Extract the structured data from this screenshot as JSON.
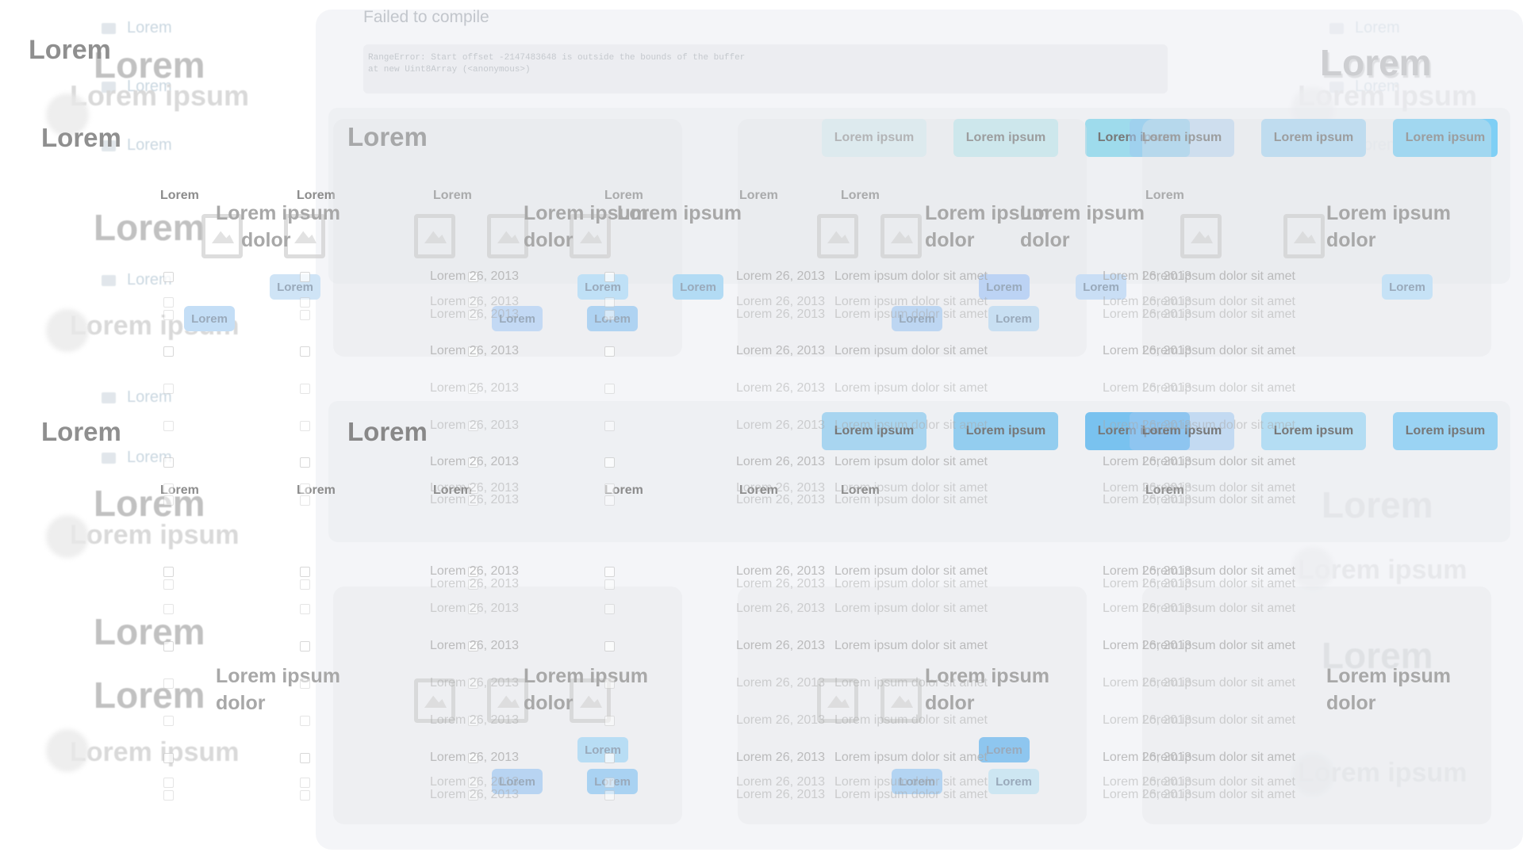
{
  "word": "Lorem",
  "lorem_ipsum": "Lorem ipsum",
  "lorem_ipsum_dolor": "Lorem ipsum dolor",
  "dolor": "dolor",
  "ipsum": "ipsum",
  "date": "Lorem 26, 2013",
  "date_short": "26, 2013",
  "sentence": "Lorem ipsum dolor sit amet",
  "overlay": {
    "title": "Failed to compile",
    "code_lines": [
      "RangeError: Start offset -2147483648 is outside the bounds of the buffer",
      "    at new Uint8Array (<anonymous>)"
    ]
  },
  "panels": [
    {
      "title": "Lorem",
      "buttons": [
        "Lorem ipsum",
        "Lorem ipsum",
        "Lorem ipsum",
        "Lorem ipsum",
        "Lorem ipsum",
        "Lorem ipsum"
      ],
      "columns": [
        "Lorem",
        "Lorem",
        "Lorem",
        "Lorem",
        "Lorem",
        "Lorem",
        "Lorem"
      ]
    },
    {
      "title": "Lorem",
      "buttons": [
        "Lorem ipsum",
        "Lorem ipsum",
        "Lorem ipsum",
        "Lorem ipsum",
        "Lorem ipsum",
        "Lorem ipsum"
      ],
      "columns": [
        "Lorem",
        "Lorem",
        "Lorem",
        "Lorem",
        "Lorem",
        "Lorem",
        "Lorem"
      ]
    }
  ],
  "rows": [
    {
      "date": "Lorem 26, 2013",
      "text": "Lorem ipsum dolor sit amet"
    },
    {
      "date": "Lorem 26, 2013",
      "text": "Lorem ipsum dolor sit amet"
    },
    {
      "date": "Lorem 26, 2013",
      "text": "Lorem ipsum dolor sit amet"
    },
    {
      "date": "Lorem 26, 2013",
      "text": "Lorem ipsum dolor sit amet"
    },
    {
      "date": "Lorem 26, 2013",
      "text": "Lorem ipsum dolor sit amet"
    },
    {
      "date": "Lorem 26, 2013",
      "text": "Lorem ipsum dolor sit amet"
    },
    {
      "date": "Lorem 26, 2013",
      "text": "Lorem ipsum dolor sit amet"
    },
    {
      "date": "Lorem 26, 2013",
      "text": "Lorem ipsum dolor sit amet"
    }
  ],
  "button_colors": [
    "#cfe9f0",
    "#bfe6ee",
    "#9fdcec",
    "#aad7f3",
    "#7fd0f5"
  ],
  "accent": "#8fc3f0"
}
